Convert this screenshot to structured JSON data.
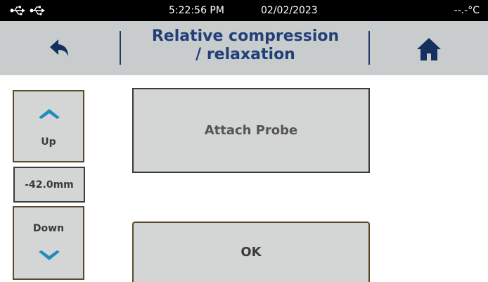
{
  "status_bar": {
    "icons": [
      "usb-icon",
      "usb-icon"
    ],
    "time": "5:22:56 PM",
    "date": "02/02/2023",
    "temperature": "--.-°C"
  },
  "header": {
    "title_line1": "Relative compression",
    "title_line2": "/ relaxation",
    "back_icon": "back-arrow-icon",
    "home_icon": "home-icon"
  },
  "controls": {
    "up_label": "Up",
    "down_label": "Down",
    "position": "-42.0mm"
  },
  "main": {
    "message": "Attach Probe",
    "ok_label": "OK"
  },
  "colors": {
    "status_bar_bg": "#000000",
    "header_bg": "#c9cccc",
    "title_color": "#213f78",
    "button_bg": "#d4d5d5",
    "chevron_color": "#1f8cc0",
    "icon_color": "#13305e"
  }
}
